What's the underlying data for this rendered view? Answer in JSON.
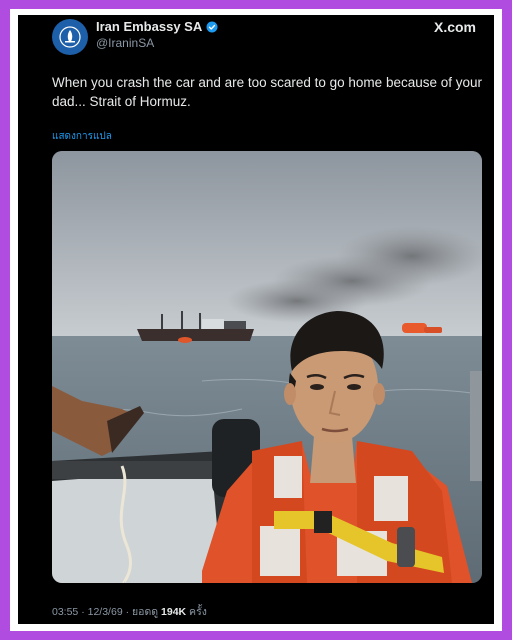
{
  "account": {
    "display_name": "Iran Embassy SA",
    "handle": "@IraninSA",
    "verified_icon": "verified-badge-icon",
    "avatar_icon": "embassy-emblem-icon"
  },
  "brand": "X.com",
  "tweet": {
    "text": "When you crash the car and are too scared to go home because of your dad... Strait of Hormuz.",
    "translate_label": "แสดงการแปล"
  },
  "meta": {
    "time": "03:55",
    "separator": " · ",
    "date": "12/3/69",
    "views_prefix": " · ยอดดู ",
    "views_count": "194K",
    "views_suffix": " ครั้ง"
  },
  "colors": {
    "frame_border": "#b04ce0",
    "background": "#000000",
    "accent_link": "#1d9bf0",
    "verified": "#1d9bf0",
    "secondary_text": "#8b98a5"
  }
}
